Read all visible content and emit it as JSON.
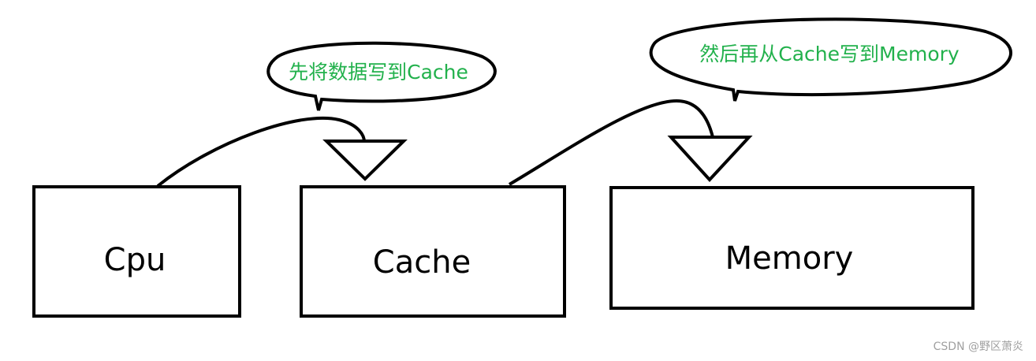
{
  "boxes": {
    "cpu": "Cpu",
    "cache": "Cache",
    "memory": "Memory"
  },
  "callouts": {
    "first": "先将数据写到Cache",
    "second": "然后再从Cache写到Memory"
  },
  "watermark": "CSDN @野区萧炎",
  "colors": {
    "callout_text": "#22b14c",
    "outline": "#000000",
    "watermark": "#a0a0a0"
  }
}
